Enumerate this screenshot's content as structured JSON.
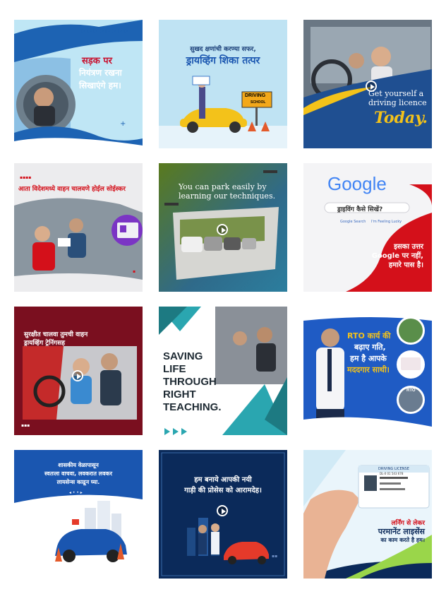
{
  "tiles": {
    "t1": {
      "line1": "सड़क पर",
      "line2": "नियंत्रण रखना",
      "line3": "सिखाएंगे हम।"
    },
    "t2": {
      "line1": "सुखद क्षणांची करण्या सफर,",
      "line2": "ड्रायव्हिंग शिका तत्पर",
      "sign1": "DRIVING",
      "sign2": "SCHOOL"
    },
    "t3": {
      "line1": "Get yourself a",
      "line2": "driving licence",
      "line3": "Today."
    },
    "t4": {
      "line1": "आता विदेशमध्ये वाहन चालवणे होईल सोईस्कर"
    },
    "t5": {
      "line1": "You can park easily by",
      "line2": "learning our techniques."
    },
    "t6": {
      "logo": "Google",
      "search": "ड्राइविंग कैसे सिखें?",
      "btn1": "Google Search",
      "btn2": "I'm Feeling Lucky",
      "line1": "इसका उत्तर",
      "line2": "Google पर नहीं,",
      "line3": "हमारे पास है।"
    },
    "t7": {
      "line1": "सुरक्षीत चालवा तुमची वाहन",
      "line2": "ड्रायव्हिंग ट्रेनिंगसह"
    },
    "t8": {
      "line1": "SAVING",
      "line2": "LIFE",
      "line3": "THROUGH",
      "line4": "RIGHT",
      "line5": "TEACHING."
    },
    "t9": {
      "line1": "RTO कार्य की",
      "line2": "बढ़ाए गति,",
      "line3": "हम है आपके",
      "line4": "मददगार साथी।",
      "badge": "RTO"
    },
    "t10": {
      "line1": "शासकीय वेळापासून",
      "line2": "स्वतःला वाचवा, लवकरात लवकर",
      "line3": "लायसेन्स काढून घ्या."
    },
    "t11": {
      "line1": "हम बनाये आपकी नयी",
      "line2": "गाड़ी की प्रोसेस को आरामदेह।"
    },
    "t12": {
      "card_title": "DRIVING LICENSE",
      "card_no": "DL-0 01 543 678",
      "line1": "लर्निंग से लेकर",
      "line2": "परमानेंट लाइसेंस",
      "line3": "का काम करते है हम।"
    }
  },
  "colors": {
    "blue": "#1a56b0",
    "red": "#d4101a",
    "maroon": "#7a0f1f",
    "teal": "#2aa6b0",
    "navy": "#0b2a5a",
    "yellow": "#f3c21a"
  }
}
